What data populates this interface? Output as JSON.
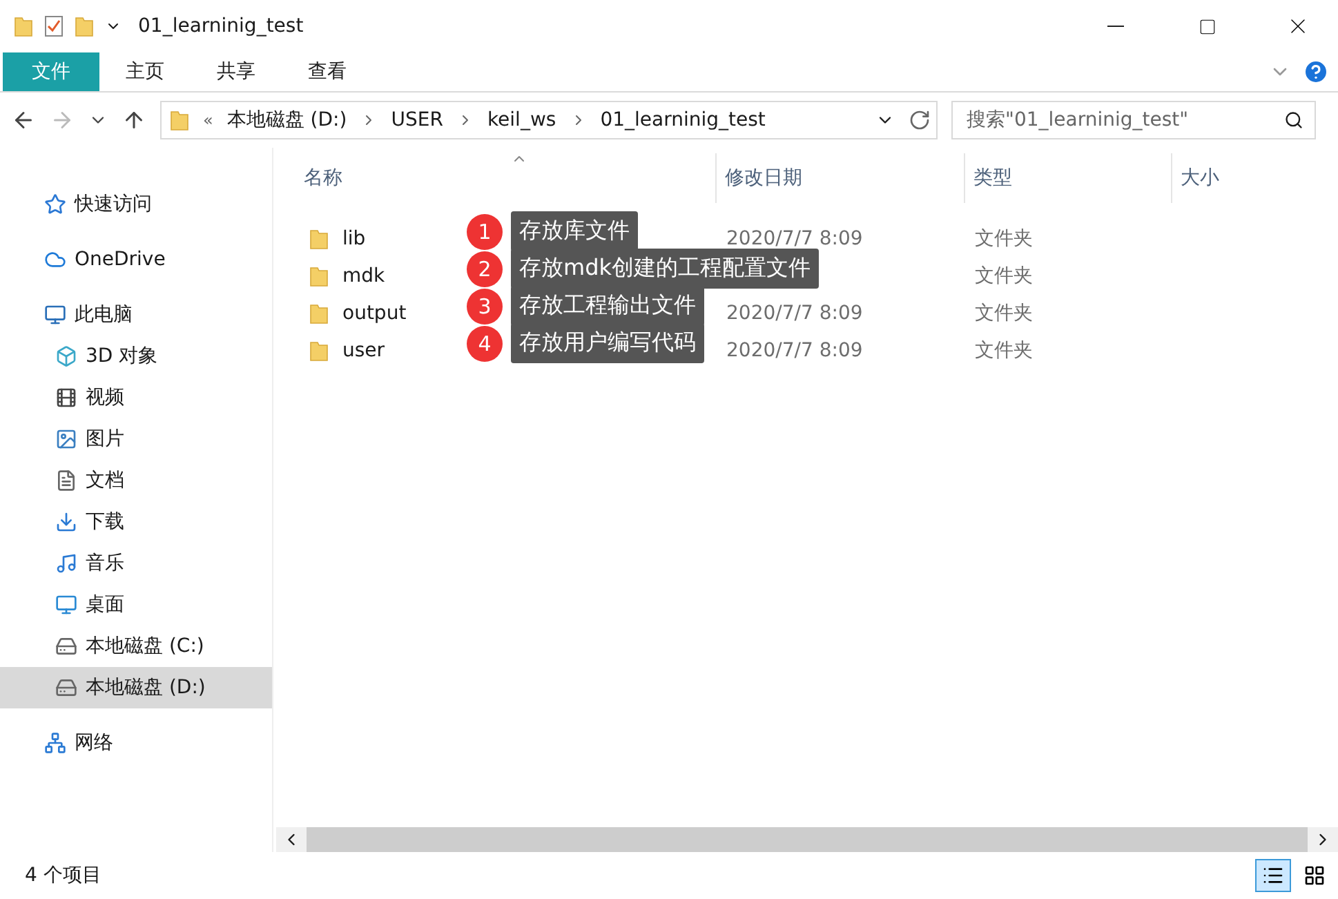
{
  "window": {
    "title": "01_learninig_test"
  },
  "ribbon_tabs": [
    {
      "label": "文件",
      "selected": true
    },
    {
      "label": "主页",
      "selected": false
    },
    {
      "label": "共享",
      "selected": false
    },
    {
      "label": "查看",
      "selected": false
    }
  ],
  "address_bar": {
    "overflow": "«",
    "path": [
      "本地磁盘 (D:)",
      "USER",
      "keil_ws",
      "01_learninig_test"
    ]
  },
  "search": {
    "placeholder": "搜索\"01_learninig_test\""
  },
  "sidebar": {
    "items": [
      {
        "label": "快速访问",
        "selected": false
      },
      {
        "label": "OneDrive",
        "selected": false
      },
      {
        "label": "此电脑",
        "selected": false,
        "children": [
          {
            "label": "3D 对象",
            "selected": false
          },
          {
            "label": "视频",
            "selected": false
          },
          {
            "label": "图片",
            "selected": false
          },
          {
            "label": "文档",
            "selected": false
          },
          {
            "label": "下载",
            "selected": false
          },
          {
            "label": "音乐",
            "selected": false
          },
          {
            "label": "桌面",
            "selected": false
          },
          {
            "label": "本地磁盘 (C:)",
            "selected": false
          },
          {
            "label": "本地磁盘 (D:)",
            "selected": true
          }
        ]
      },
      {
        "label": "网络",
        "selected": false
      }
    ]
  },
  "table": {
    "columns": [
      "名称",
      "修改日期",
      "类型",
      "大小"
    ],
    "rows": [
      {
        "name": "lib",
        "modified": "2020/7/7 8:09",
        "type": "文件夹"
      },
      {
        "name": "mdk",
        "modified": null,
        "type": "文件夹"
      },
      {
        "name": "output",
        "modified": "2020/7/7 8:09",
        "type": "文件夹"
      },
      {
        "name": "user",
        "modified": "2020/7/7 8:09",
        "type": "文件夹"
      }
    ]
  },
  "annotations": [
    {
      "number": "1",
      "text": "存放库文件"
    },
    {
      "number": "2",
      "text": "存放mdk创建的工程配置文件"
    },
    {
      "number": "3",
      "text": "存放工程输出文件"
    },
    {
      "number": "4",
      "text": "存放用户编写代码"
    }
  ],
  "status_bar": {
    "item_count": "4 个项目"
  }
}
